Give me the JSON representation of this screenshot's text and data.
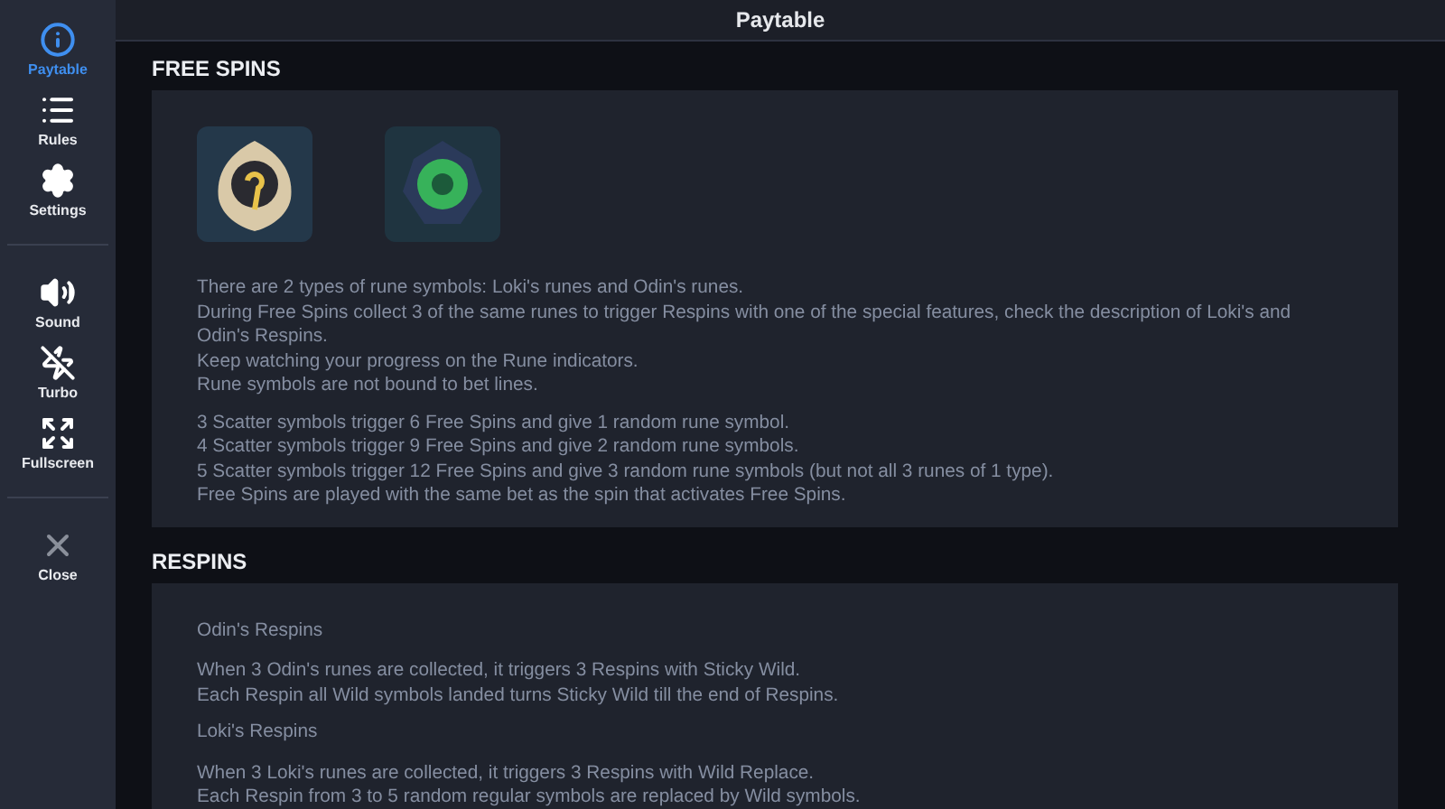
{
  "header": {
    "title": "Paytable"
  },
  "sidebar": {
    "groups": [
      [
        {
          "label": "Paytable",
          "kind": "info",
          "selected": true
        },
        {
          "label": "Rules",
          "kind": "list",
          "selected": false
        },
        {
          "label": "Settings",
          "kind": "gear",
          "selected": false
        }
      ],
      [
        {
          "label": "Sound",
          "kind": "sound",
          "selected": false
        },
        {
          "label": "Turbo",
          "kind": "turbo",
          "selected": false
        },
        {
          "label": "Fullscreen",
          "kind": "fullscreen",
          "selected": false
        }
      ],
      [
        {
          "label": "Close",
          "kind": "close",
          "selected": false
        }
      ]
    ]
  },
  "sections": [
    {
      "title": "FREE SPINS",
      "blocks": [
        {
          "kind": "symbols"
        },
        {
          "kind": "lines",
          "lines": [
            "There are 2 types of rune symbols: Loki's runes and Odin's runes.",
            "During Free Spins collect 3 of the same runes to trigger Respins with one of the special features, check the description of Loki's and Odin's Respins.",
            "Keep watching your progress on the Rune indicators.",
            "Rune symbols are not bound to bet lines."
          ]
        },
        {
          "kind": "lines",
          "lines": [
            "3 Scatter symbols trigger 6 Free Spins and give 1 random rune symbol.",
            "4 Scatter symbols trigger 9 Free Spins and give 2 random rune symbols.",
            "5 Scatter symbols trigger 12 Free Spins and give 3 random rune symbols (but not all 3 runes of 1 type).",
            "Free Spins are played with the same bet as the spin that activates Free Spins."
          ]
        }
      ]
    },
    {
      "title": "RESPINS",
      "blocks": [
        {
          "kind": "subtitle",
          "text": "Odin's Respins"
        },
        {
          "kind": "lines",
          "lines": [
            "When 3 Odin's runes are collected, it triggers 3 Respins with Sticky Wild.",
            "Each Respin all Wild symbols landed turns Sticky Wild till the end of Respins."
          ]
        },
        {
          "kind": "subtitle",
          "text": "Loki's Respins"
        },
        {
          "kind": "lines",
          "lines": [
            "When 3 Loki's runes are collected, it triggers 3 Respins with Wild Replace.",
            "Each Respin from 3 to 5 random regular symbols are replaced by Wild symbols."
          ]
        }
      ]
    }
  ]
}
